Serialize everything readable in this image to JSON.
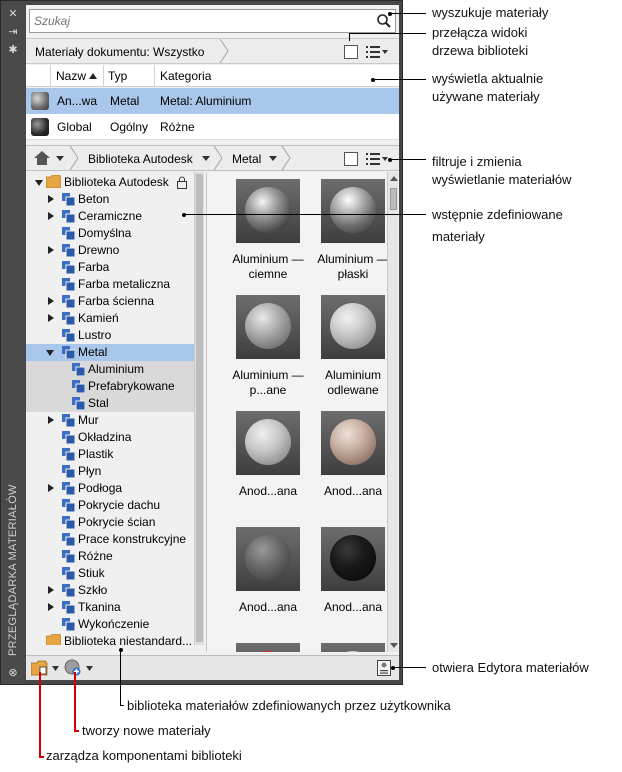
{
  "palette": {
    "sidebar_title": "PRZEGLĄDARKA MATERIAŁÓW",
    "sidebar_icons": [
      "close-icon",
      "pin-icon",
      "settings-icon"
    ]
  },
  "search": {
    "placeholder": "Szukaj",
    "icon": "search-icon"
  },
  "document_materials": {
    "filter_label": "Materiały dokumentu: Wszystko",
    "columns": [
      "Nazw",
      "Typ",
      "Kategoria"
    ],
    "rows": [
      {
        "name": "An...wa",
        "type": "Metal",
        "category": "Metal: Aluminium",
        "selected": true
      },
      {
        "name": "Global",
        "type": "Ogólny",
        "category": "Różne",
        "selected": false
      }
    ]
  },
  "library": {
    "breadcrumb": [
      "Biblioteka Autodesk",
      "Metal"
    ],
    "tree_root": "Biblioteka Autodesk",
    "tree_items": [
      {
        "label": "Beton",
        "expandable": true
      },
      {
        "label": "Ceramiczne",
        "expandable": true
      },
      {
        "label": "Domyślna",
        "expandable": false
      },
      {
        "label": "Drewno",
        "expandable": true
      },
      {
        "label": "Farba",
        "expandable": false
      },
      {
        "label": "Farba metaliczna",
        "expandable": false
      },
      {
        "label": "Farba ścienna",
        "expandable": true
      },
      {
        "label": "Kamień",
        "expandable": true
      },
      {
        "label": "Lustro",
        "expandable": false
      },
      {
        "label": "Metal",
        "expandable": true,
        "open": true,
        "selected": true
      },
      {
        "label": "Aluminium",
        "child": true
      },
      {
        "label": "Prefabrykowane",
        "child": true
      },
      {
        "label": "Stal",
        "child": true
      },
      {
        "label": "Mur",
        "expandable": true
      },
      {
        "label": "Okładzina",
        "expandable": false
      },
      {
        "label": "Plastik",
        "expandable": false
      },
      {
        "label": "Płyn",
        "expandable": false
      },
      {
        "label": "Podłoga",
        "expandable": true
      },
      {
        "label": "Pokrycie dachu",
        "expandable": false
      },
      {
        "label": "Pokrycie ścian",
        "expandable": false
      },
      {
        "label": "Prace konstrukcyjne",
        "expandable": false
      },
      {
        "label": "Różne",
        "expandable": false
      },
      {
        "label": "Stiuk",
        "expandable": false
      },
      {
        "label": "Szkło",
        "expandable": true
      },
      {
        "label": "Tkanina",
        "expandable": true
      },
      {
        "label": "Wykończenie",
        "expandable": false
      }
    ],
    "user_library": "Biblioteka niestandard...",
    "materials": [
      {
        "caption": "Aluminium — ciemne"
      },
      {
        "caption": "Aluminium — płaski"
      },
      {
        "caption": "Aluminium — p...ane"
      },
      {
        "caption": "Aluminium odlewane"
      },
      {
        "caption": "Anod...ana"
      },
      {
        "caption": "Anod...ana"
      },
      {
        "caption": "Anod...ana"
      },
      {
        "caption": "Anod...ana"
      },
      {
        "caption": ""
      },
      {
        "caption": ""
      }
    ]
  },
  "colors": {
    "selection": "#a9c7ea",
    "panel_dark": "#474747",
    "callout_red": "#d40000"
  },
  "callouts": {
    "search": "wyszukuje materiały",
    "toggle_view_1": "przełącza widoki",
    "toggle_view_2": "drzewa biblioteki",
    "in_use_1": "wyświetla aktualnie",
    "in_use_2": "używane materiały",
    "filter_1": "filtruje i zmienia",
    "filter_2": "wyświetlanie materiałów",
    "predefined_1": "wstępnie zdefiniowane",
    "predefined_2": "materiały",
    "editor": "otwiera Edytora materiałów",
    "user_library": "biblioteka materiałów zdefiniowanych przez użytkownika",
    "create_new": "tworzy nowe materiały",
    "manage": "zarządza komponentami biblioteki"
  }
}
